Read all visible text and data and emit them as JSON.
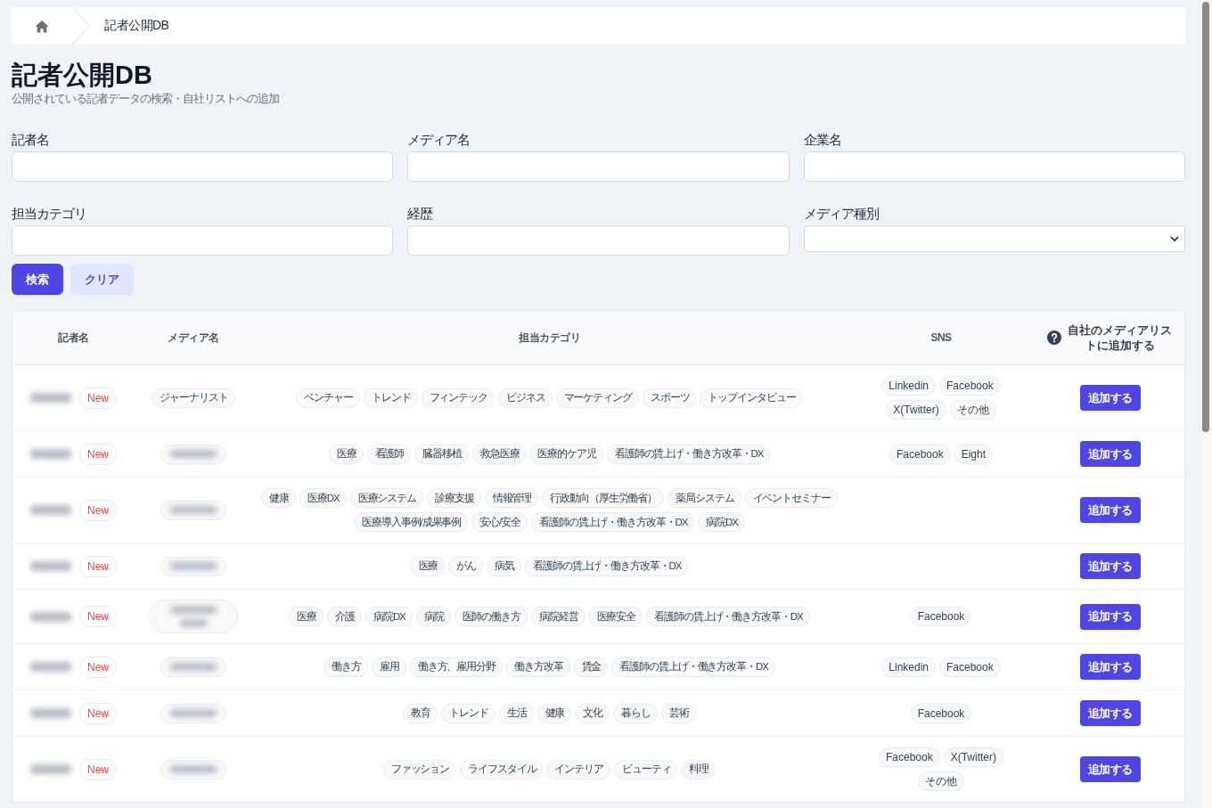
{
  "breadcrumb": {
    "current": "記者公開DB"
  },
  "header": {
    "title": "記者公開DB",
    "subtitle": "公開されている記者データの検索・自社リストへの追加"
  },
  "search_form": {
    "fields": [
      {
        "label": "記者名",
        "kind": "text"
      },
      {
        "label": "メディア名",
        "kind": "text"
      },
      {
        "label": "企業名",
        "kind": "text"
      },
      {
        "label": "担当カテゴリ",
        "kind": "text"
      },
      {
        "label": "経歴",
        "kind": "text"
      },
      {
        "label": "メディア種別",
        "kind": "select"
      }
    ],
    "buttons": [
      {
        "label": "検索",
        "kind": "primary"
      },
      {
        "label": "クリア",
        "kind": "secondary"
      }
    ]
  },
  "table": {
    "columns": [
      {
        "label": "記者名",
        "help": false
      },
      {
        "label": "メディア名",
        "help": false
      },
      {
        "label": "担当カテゴリ",
        "help": false
      },
      {
        "label": "SNS",
        "help": false
      },
      {
        "label": "自社のメディアリストに追加する",
        "help": true
      }
    ],
    "rows": [
      {
        "reporter": {
          "kind": "blurred"
        },
        "badge": "New",
        "media": {
          "kind": "text",
          "text": "ジャーナリスト"
        },
        "categories": [
          "ベンチャー",
          "トレンド",
          "フィンテック",
          "ビジネス",
          "マーケティング",
          "スポーツ",
          "トップインタビュー"
        ],
        "sns": [
          "Linkedin",
          "Facebook",
          "X(Twitter)",
          "その他"
        ],
        "action": "追加する"
      },
      {
        "reporter": {
          "kind": "blurred"
        },
        "badge": "New",
        "media": {
          "kind": "blurred"
        },
        "categories": [
          "医療",
          "看護師",
          "臓器移植",
          "救急医療",
          "医療的ケア児",
          "看護師の賃上げ・働き方改革・DX"
        ],
        "sns": [
          "Facebook",
          "Eight"
        ],
        "action": "追加する"
      },
      {
        "reporter": {
          "kind": "blurred"
        },
        "badge": "New",
        "media": {
          "kind": "blurred"
        },
        "categories": [
          "健康",
          "医療DX",
          "医療システム",
          "診療支援",
          "情報管理",
          "行政動向（厚生労働省）",
          "薬局システム",
          "イベントセミナー",
          "医療導入事例/成果事例",
          "安心/安全",
          "看護師の賃上げ・働き方改革・DX",
          "病院DX"
        ],
        "sns": [],
        "action": "追加する"
      },
      {
        "reporter": {
          "kind": "blurred"
        },
        "badge": "New",
        "media": {
          "kind": "blurred"
        },
        "categories": [
          "医療",
          "がん",
          "病気",
          "看護師の賃上げ・働き方改革・DX"
        ],
        "sns": [],
        "action": "追加する"
      },
      {
        "reporter": {
          "kind": "blurred"
        },
        "badge": "New",
        "media": {
          "kind": "blurred_tall"
        },
        "categories": [
          "医療",
          "介護",
          "病院DX",
          "病院",
          "医師の働き方",
          "病院経営",
          "医療安全",
          "看護師の賃上げ・働き方改革・DX"
        ],
        "sns": [
          "Facebook"
        ],
        "action": "追加する"
      },
      {
        "reporter": {
          "kind": "blurred"
        },
        "badge": "New",
        "media": {
          "kind": "blurred"
        },
        "categories": [
          "働き方",
          "雇用",
          "働き方、雇用分野",
          "働き方改革",
          "賃金",
          "看護師の賃上げ・働き方改革・DX"
        ],
        "sns": [
          "Linkedin",
          "Facebook"
        ],
        "action": "追加する"
      },
      {
        "reporter": {
          "kind": "blurred"
        },
        "badge": "New",
        "media": {
          "kind": "blurred"
        },
        "categories": [
          "教育",
          "トレンド",
          "生活",
          "健康",
          "文化",
          "暮らし",
          "芸術"
        ],
        "sns": [
          "Facebook"
        ],
        "action": "追加する"
      },
      {
        "reporter": {
          "kind": "blurred"
        },
        "badge": "New",
        "media": {
          "kind": "blurred"
        },
        "categories": [
          "ファッション",
          "ライフスタイル",
          "インテリア",
          "ビューティ",
          "料理"
        ],
        "sns": [
          "Facebook",
          "X(Twitter)",
          "その他"
        ],
        "action": "追加する"
      }
    ]
  }
}
